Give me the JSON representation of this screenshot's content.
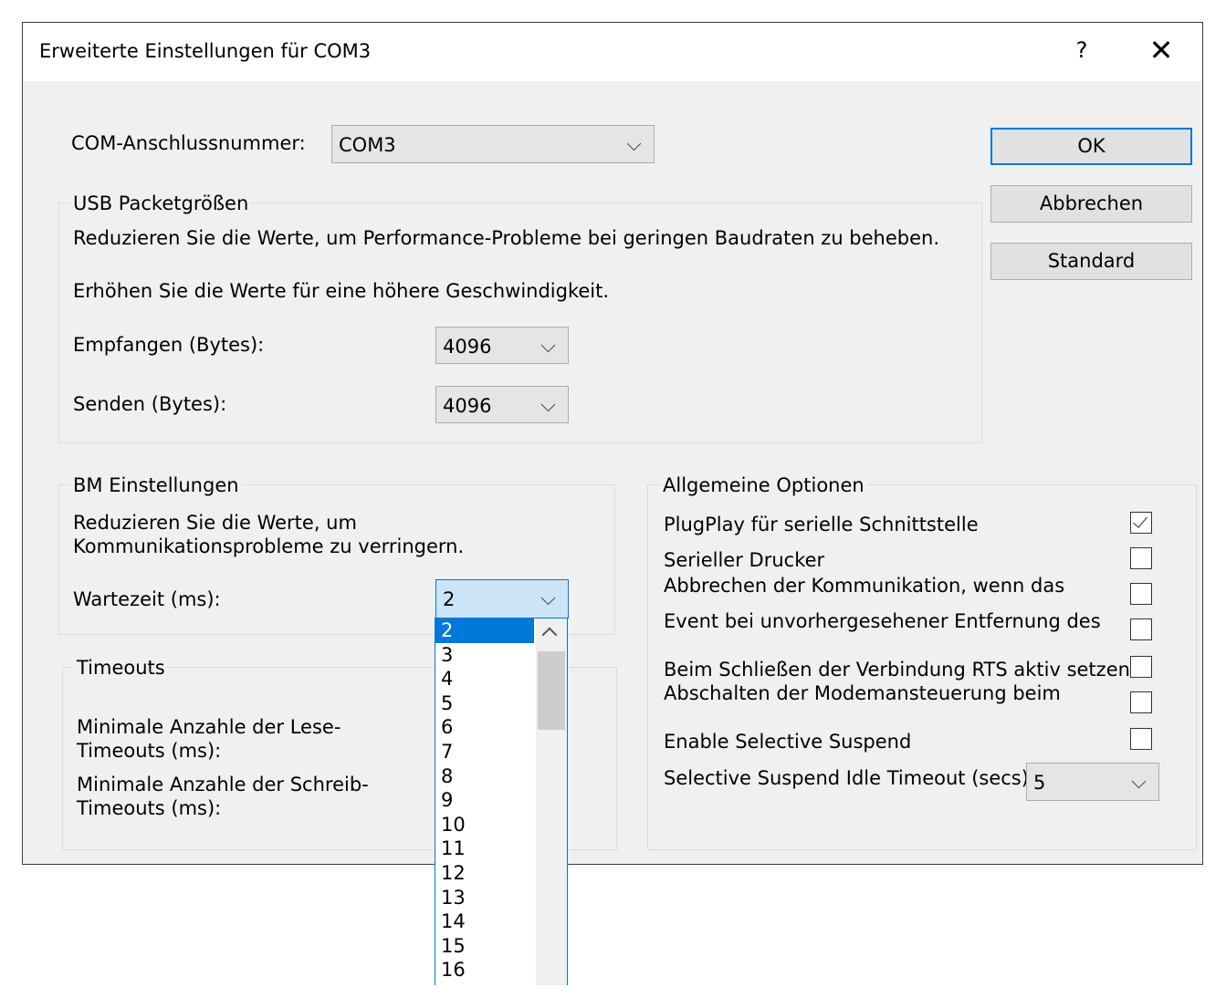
{
  "window": {
    "title": "Erweiterte Einstellungen für COM3",
    "help": "?",
    "close": "✕"
  },
  "com_port": {
    "label": "COM-Anschlussnummer:",
    "value": "COM3"
  },
  "buttons": {
    "ok": "OK",
    "cancel": "Abbrechen",
    "default": "Standard"
  },
  "usb": {
    "legend": "USB Packetgrößen",
    "desc1": "Reduzieren Sie die Werte, um Performance-Probleme bei geringen Baudraten zu beheben.",
    "desc2": "Erhöhen Sie die Werte für eine höhere Geschwindigkeit.",
    "receive_label": "Empfangen (Bytes):",
    "receive_value": "4096",
    "send_label": "Senden (Bytes):",
    "send_value": "4096"
  },
  "bm": {
    "legend": "BM Einstellungen",
    "desc": "Reduzieren Sie die Werte, um Kommunikationsprobleme zu verringern.",
    "latency_label": "Wartezeit (ms):",
    "latency_value": "2"
  },
  "timeouts": {
    "legend": "Timeouts",
    "read_label": "Minimale Anzahle der Lese-Timeouts (ms):",
    "write_label": "Minimale Anzahle der Schreib-Timeouts (ms):"
  },
  "options": {
    "legend": "Allgemeine Optionen",
    "items": [
      {
        "label": "PlugPlay für serielle Schnittstelle",
        "checked": true
      },
      {
        "label": "Serieller Drucker",
        "checked": false
      },
      {
        "label": "Abbrechen der Kommunikation, wenn das Gerät ausgeschaltet wird",
        "checked": false
      },
      {
        "label": "Event bei unvorhergesehener Entfernung des Geräts",
        "checked": false
      },
      {
        "label": "Beim Schließen der Verbindung RTS aktiv setzen",
        "checked": false
      },
      {
        "label": "Abschalten der Modemansteuerung beim Hochfahren des Geräts",
        "checked": false
      },
      {
        "label": "Enable Selective Suspend",
        "checked": false
      }
    ],
    "idle_label": "Selective Suspend Idle Timeout (secs):",
    "idle_value": "5"
  },
  "dropdown": {
    "items": [
      "2",
      "3",
      "4",
      "5",
      "6",
      "7",
      "8",
      "9",
      "10",
      "11",
      "12",
      "13",
      "14",
      "15",
      "16"
    ],
    "selected": "2"
  }
}
